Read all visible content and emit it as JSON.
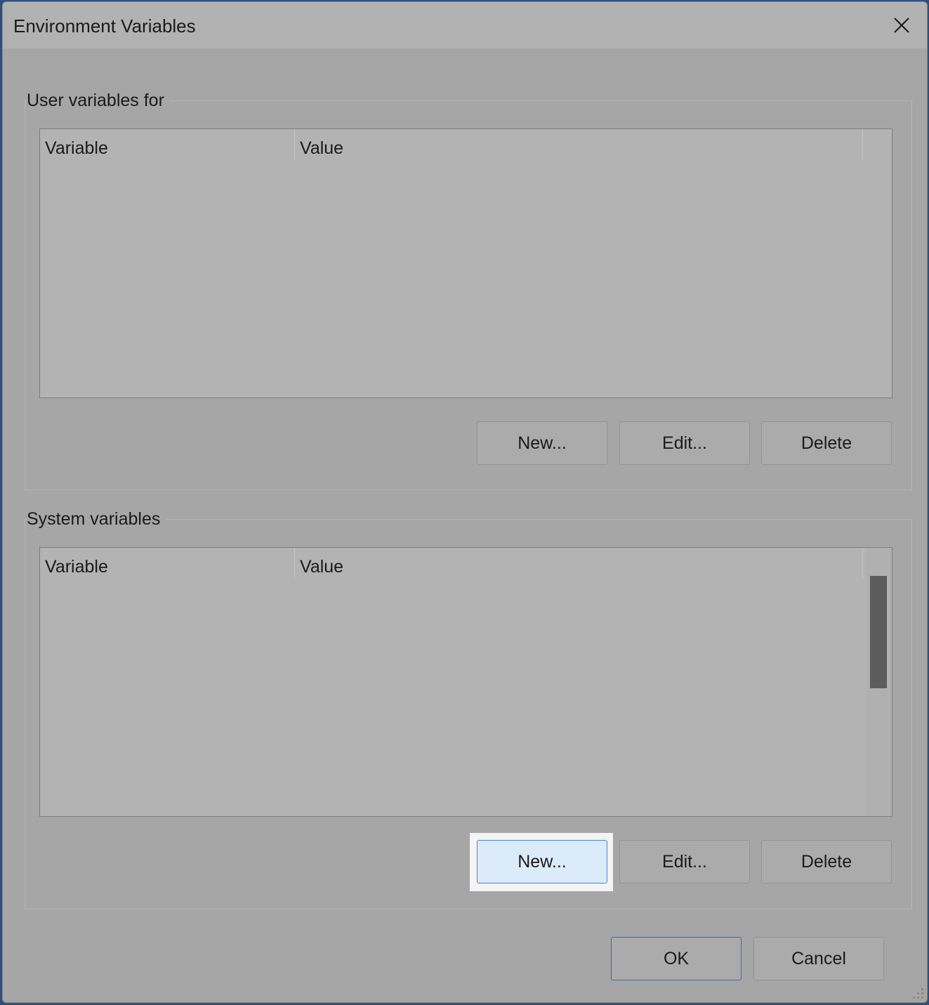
{
  "window": {
    "title": "Environment Variables"
  },
  "user_section": {
    "label": "User variables for",
    "columns": [
      "Variable",
      "Value"
    ],
    "rows": [],
    "buttons": {
      "new": "New...",
      "edit": "Edit...",
      "delete": "Delete"
    }
  },
  "system_section": {
    "label": "System variables",
    "columns": [
      "Variable",
      "Value"
    ],
    "rows": [],
    "buttons": {
      "new": "New...",
      "edit": "Edit...",
      "delete": "Delete"
    }
  },
  "footer": {
    "ok": "OK",
    "cancel": "Cancel"
  },
  "icons": {
    "close": "close-icon",
    "resize": "resize-grip-icon"
  },
  "colors": {
    "highlight_button_bg": "#dcebfa",
    "primary_border": "#3a6ea5"
  }
}
